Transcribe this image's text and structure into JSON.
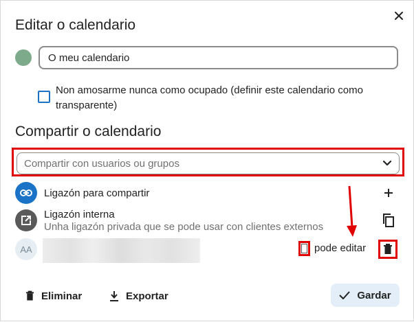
{
  "dialog": {
    "title": "Editar o calendario",
    "close_icon": "close-icon"
  },
  "calendar": {
    "color": "#7eaa8c",
    "name_value": "O meu calendario",
    "transparent_label": "Non amosarme nunca como ocupado (definir este calendario como transparente)",
    "transparent_checked": false
  },
  "sharing": {
    "section_title": "Compartir o calendario",
    "search_placeholder": "Compartir con usuarios ou grupos",
    "share_link": {
      "label": "Ligazón para compartir",
      "icon": "link-icon",
      "action_icon": "plus-icon"
    },
    "internal_link": {
      "label": "Ligazón interna",
      "sublabel": "Unha ligazón privada que se pode usar con clientes externos",
      "icon": "external-link-icon",
      "action_icon": "copy-icon"
    },
    "sharee": {
      "avatar_initials": "AA",
      "can_edit_label": "pode editar",
      "can_edit_checked": false
    }
  },
  "footer": {
    "delete_label": "Eliminar",
    "export_label": "Exportar",
    "save_label": "Gardar"
  },
  "colors": {
    "accent_blue": "#1a73c6",
    "annotation_red": "#e00000",
    "save_bg": "#e4eef8"
  }
}
